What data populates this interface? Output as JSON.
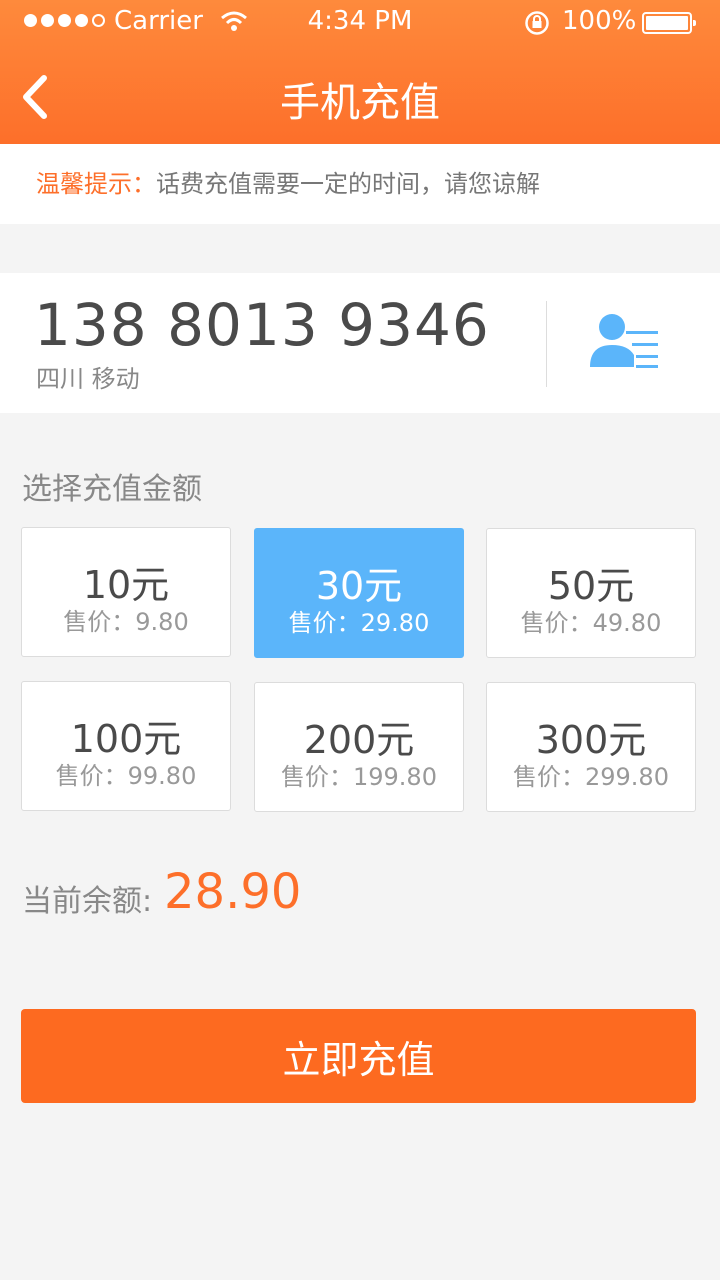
{
  "status_bar": {
    "carrier": "Carrier",
    "time": "4:34 PM",
    "battery": "100%"
  },
  "nav": {
    "title": "手机充值",
    "back_icon": "chevron-left-icon"
  },
  "tip": {
    "label": "温馨提示：",
    "text": "话费充值需要一定的时间，请您谅解"
  },
  "phone": {
    "number": "138 8013 9346",
    "region": "四川 移动",
    "contacts_icon": "contact-list-icon"
  },
  "amounts": {
    "title": "选择充值金额",
    "items": [
      {
        "value": "10元",
        "price": "售价：9.80"
      },
      {
        "value": "30元",
        "price": "售价：29.80"
      },
      {
        "value": "50元",
        "price": "售价：49.80"
      },
      {
        "value": "100元",
        "price": "售价：99.80"
      },
      {
        "value": "200元",
        "price": "售价：199.80"
      },
      {
        "value": "300元",
        "price": "售价：299.80"
      }
    ]
  },
  "balance": {
    "label": "当前余额:",
    "value": "28.90"
  },
  "action": {
    "label": "立即充值"
  },
  "colors": {
    "accent": "#fd6f2a",
    "selected": "#5bb5fa"
  }
}
